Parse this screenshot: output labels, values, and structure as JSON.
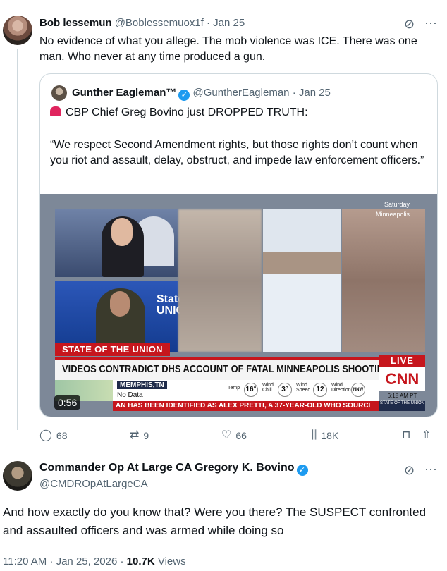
{
  "reply": {
    "name": "Bob lessemun",
    "handle": "@Boblessemuox1f",
    "date": "Jan 25",
    "text": "No evidence of what you allege. The mob violence was ICE. There was one man. Who never at any time produced a gun."
  },
  "quote": {
    "name": "Gunther Eagleman™",
    "handle": "@GuntherEagleman",
    "date": "Jan 25",
    "line1": "CBP Chief Greg Bovino just DROPPED TRUTH:",
    "line2": "“We respect Second Amendment rights, but those rights don’t count when you riot and assault, delay, obstruct, and impede law enforcement officers.”",
    "video": {
      "show_tag": "STATE OF THE UNION",
      "headline": "VIDEOS CONTRADICT DHS ACCOUNT OF FATAL MINNEAPOLIS SHOOTING",
      "live": "LIVE",
      "network": "CNN",
      "city": "MEMPHIS,TN",
      "city_sub": "No Data",
      "ticker": "AN HAS BEEN IDENTIFIED AS ALEX PRETTI, A 37-YEAR-OLD WHO SOURCI",
      "weather_corner_1": "Saturday",
      "weather_corner_2": "Minneapolis",
      "guest_overlay": "State UNIO",
      "temp_label": "Temp",
      "temp": "16°",
      "windchill_label": "Wind Chill",
      "windchill": "3°",
      "windspeed_label": "Wind Speed",
      "windspeed": "12",
      "winddir_label": "Wind Direction",
      "winddir": "NNW",
      "clock": "6:18 AM PT",
      "show_small": "STATE OF THE UNION",
      "duration": "0:56"
    }
  },
  "actions": {
    "replies": "68",
    "reposts": "9",
    "likes": "66",
    "views": "18K"
  },
  "main": {
    "name": "Commander Op At Large CA Gregory K. Bovino",
    "handle": "@CMDROpAtLargeCA",
    "text": "And how exactly do you know that?  Were you there?  The SUSPECT confronted and assaulted officers and was armed while doing so",
    "time": "11:20 AM · Jan 25, 2026 · ",
    "views_count": "10.7K",
    "views_label": " Views"
  }
}
